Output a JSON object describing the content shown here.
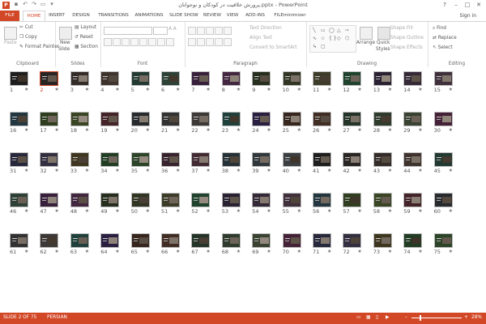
{
  "app": {
    "title": "پرورش خلاقیت در کودکان و نوجوانان.pptx - PowerPoint",
    "icon_label": "P",
    "sign_in": "Sign in",
    "controls": [
      "?",
      "–",
      "□",
      "✕"
    ]
  },
  "qat": [
    "save-icon",
    "undo-icon",
    "redo-icon",
    "present-icon",
    "customize-icon"
  ],
  "tabs": [
    "FILE",
    "HOME",
    "INSERT",
    "DESIGN",
    "TRANSITIONS",
    "ANIMATIONS",
    "SLIDE SHOW",
    "REVIEW",
    "VIEW",
    "ADD-INS",
    "FILEminimizer"
  ],
  "active_tab": "HOME",
  "ribbon": {
    "clipboard": {
      "paste": "Paste",
      "cut": "Cut",
      "copy": "Copy",
      "format_painter": "Format Painter",
      "label": "Clipboard"
    },
    "slides": {
      "new_slide": "New",
      "new_slide2": "Slide",
      "layout": "Layout",
      "reset": "Reset",
      "section": "Section",
      "label": "Slides"
    },
    "font": {
      "label": "Font",
      "size": "A A"
    },
    "paragraph": {
      "text_direction": "Text Direction",
      "align_text": "Align Text",
      "convert": "Convert to SmartArt",
      "label": "Paragraph"
    },
    "drawing": {
      "arrange": "Arrange",
      "quick_styles": "Quick",
      "quick_styles2": "Styles",
      "shape_fill": "Shape Fill",
      "shape_outline": "Shape Outline",
      "shape_effects": "Shape Effects",
      "label": "Drawing"
    },
    "editing": {
      "find": "Find",
      "replace": "Replace",
      "select": "Select",
      "label": "Editing"
    }
  },
  "sorter": {
    "selected_slide": 2,
    "star": "★",
    "slides": [
      "1",
      "2",
      "3",
      "4",
      "5",
      "6",
      "7",
      "8",
      "9",
      "10",
      "11",
      "12",
      "13",
      "14",
      "15",
      "16",
      "17",
      "18",
      "19",
      "20",
      "21",
      "22",
      "23",
      "24",
      "25",
      "26",
      "27",
      "28",
      "29",
      "30",
      "31",
      "32",
      "33",
      "34",
      "35",
      "36",
      "37",
      "38",
      "39",
      "40",
      "41",
      "42",
      "43",
      "44",
      "45",
      "46",
      "47",
      "48",
      "49",
      "50",
      "51",
      "52",
      "53",
      "54",
      "55",
      "56",
      "57",
      "58",
      "59",
      "60",
      "61",
      "62",
      "63",
      "64",
      "65",
      "66",
      "67",
      "68",
      "69",
      "70",
      "71",
      "72",
      "73",
      "74",
      "75"
    ]
  },
  "status": {
    "slide_pos": "SLIDE 2 OF 75",
    "language": "PERSIAN",
    "zoom": "28%",
    "minus": "–",
    "plus": "+"
  },
  "colors": {
    "accent": "#d24726"
  }
}
